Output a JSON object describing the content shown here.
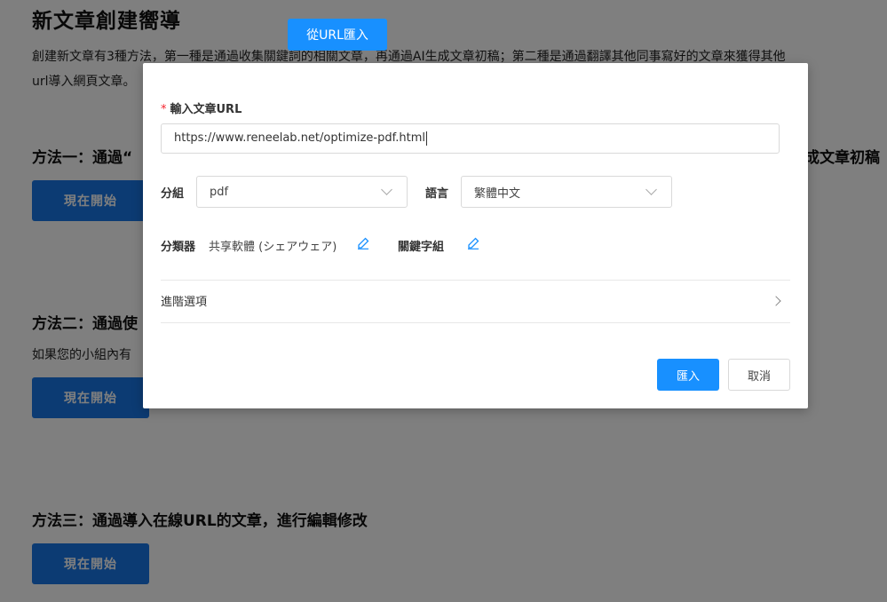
{
  "page": {
    "title": "新文章創建嚮導",
    "intro_line1": "創建新文章有3種方法，第一種是通過收集關鍵詞的相關文章，再通過AI生成文章初稿；第二種是通過翻譯其他同事寫好的文章來獲得其他",
    "intro_line2": "url導入網頁文章。",
    "method1_title": "方法一：通過“",
    "method1_title_tail": "成文章初稿",
    "method2_title": "方法二：通過使",
    "method2_desc": "如果您的小組內有",
    "method3_title": "方法三：通過導入在線URL的文章，進行編輯修改",
    "start_label": "現在開始"
  },
  "dialog": {
    "tab_label": "從URL匯入",
    "url_label": "輸入文章URL",
    "required_mark": "*",
    "url_value": "https://www.reneelab.net/optimize-pdf.html",
    "group_label": "分組",
    "group_value": "pdf",
    "language_label": "語言",
    "language_value": "繁體中文",
    "classifier_label": "分類器",
    "classifier_value": "共享軟體 (シェアウェア)",
    "keyword_label": "關鍵字組",
    "advanced_label": "進階選項",
    "import_label": "匯入",
    "cancel_label": "取消"
  },
  "colors": {
    "primary": "#1890ff",
    "start_button": "#1877e6",
    "required": "#f5222d"
  },
  "icons": {
    "edit": "pencil-icon",
    "select_arrow": "chevron-down-icon",
    "advanced_arrow": "chevron-right-icon"
  }
}
